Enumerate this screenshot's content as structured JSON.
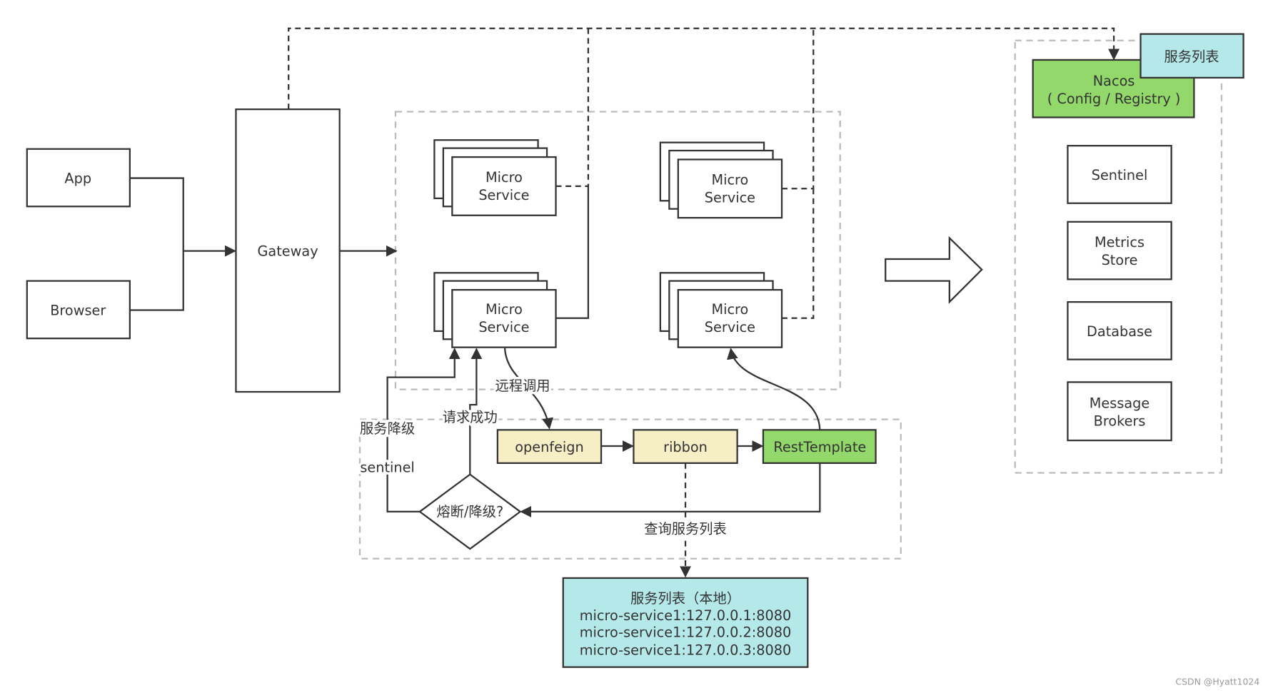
{
  "clients": {
    "app": "App",
    "browser": "Browser"
  },
  "gateway": "Gateway",
  "micro_service": [
    "Micro",
    "Service"
  ],
  "nacos": {
    "line1": "Nacos",
    "line2": "( Config / Registry )",
    "tag": "服务列表"
  },
  "infra": {
    "sentinel": "Sentinel",
    "metrics": [
      "Metrics",
      "Store"
    ],
    "database": "Database",
    "message": [
      "Message",
      "Brokers"
    ]
  },
  "flow": {
    "openfeign": "openfeign",
    "ribbon": "ribbon",
    "rest_template": "RestTemplate",
    "remote_call": "远程调用",
    "request_success": "请求成功",
    "service_degrade": "服务降级",
    "sentinel": "sentinel",
    "decision": "熔断/降级?",
    "query_list": "查询服务列表"
  },
  "local_list": {
    "title": "服务列表（本地）",
    "items": [
      "micro-service1:127.0.0.1:8080",
      "micro-service1:127.0.0.2:8080",
      "micro-service1:127.0.0.3:8080"
    ]
  },
  "watermark": "CSDN @Hyatt1024",
  "colors": {
    "cyan": "#b5e8e9",
    "green": "#92d86a",
    "yellow": "#f6efc6",
    "line": "#333333"
  }
}
